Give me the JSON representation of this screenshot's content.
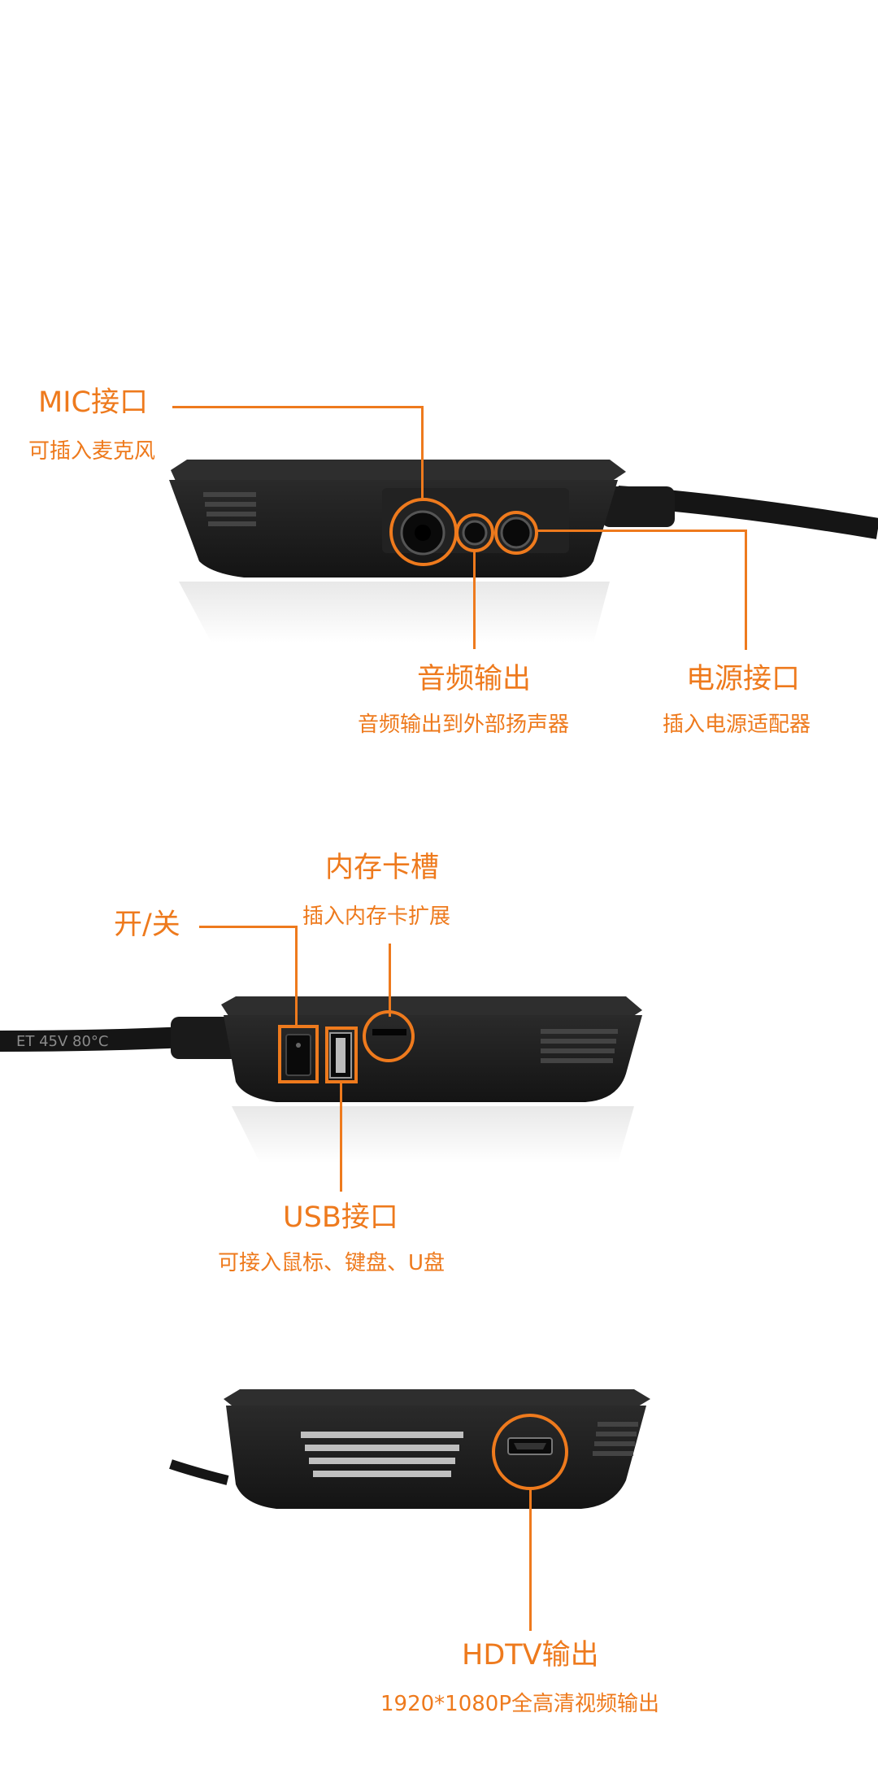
{
  "colors": {
    "accent": "#ee7a1d",
    "device": "#1e1e1e",
    "background": "#ffffff"
  },
  "panel1": {
    "mic": {
      "title": "MIC接口",
      "desc": "可插入麦克风"
    },
    "audio_out": {
      "title": "音频输出",
      "desc": "音频输出到外部扬声器"
    },
    "power": {
      "title": "电源接口",
      "desc": "插入电源适配器"
    }
  },
  "panel2": {
    "card_slot": {
      "title": "内存卡槽",
      "desc": "插入内存卡扩展"
    },
    "power_switch": {
      "title": "开/关"
    },
    "usb": {
      "title": "USB接口",
      "desc": "可接入鼠标、键盘、U盘"
    },
    "cable_print": "ET 45V 80°C"
  },
  "panel3": {
    "hdtv": {
      "title": "HDTV输出",
      "desc": "1920*1080P全高清视频输出"
    }
  }
}
